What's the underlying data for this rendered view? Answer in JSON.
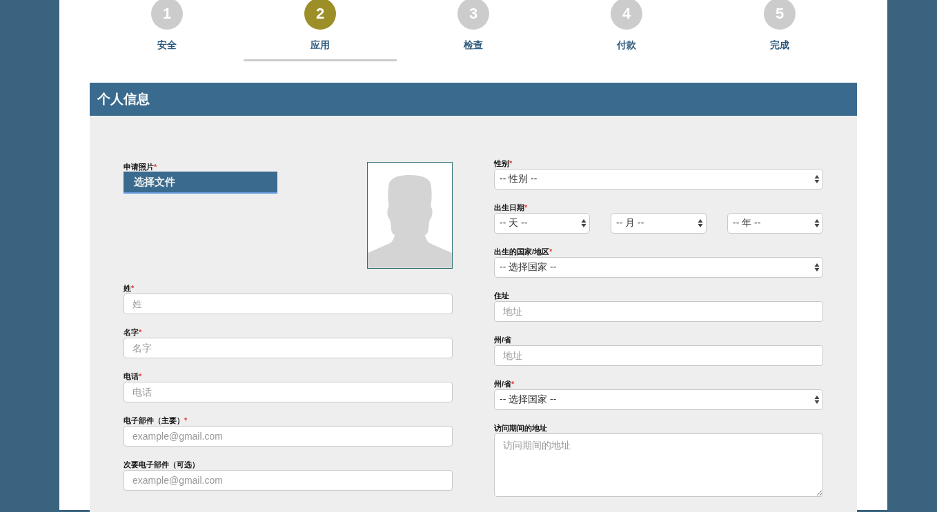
{
  "steps": [
    {
      "number": "1",
      "label": "安全",
      "selected": false
    },
    {
      "number": "2",
      "label": "应用",
      "selected": true
    },
    {
      "number": "3",
      "label": "检查",
      "selected": false
    },
    {
      "number": "4",
      "label": "付款",
      "selected": false
    },
    {
      "number": "5",
      "label": "完成",
      "selected": false
    }
  ],
  "section": {
    "title": "个人信息",
    "left_fields": [
      {
        "kind": "photo",
        "label": "申请照片",
        "required_mark": "*",
        "button": "选择文件"
      },
      {
        "kind": "text",
        "label": "姓",
        "required_mark": "*",
        "placeholder": "姓"
      },
      {
        "kind": "text",
        "label": "名字",
        "required_mark": "*",
        "placeholder": "名字"
      },
      {
        "kind": "text",
        "label": "电话",
        "required_mark": "*",
        "placeholder": "电话"
      },
      {
        "kind": "text",
        "label": "电子部件（主要）",
        "required_mark": "*",
        "placeholder": "example@gmail.com"
      },
      {
        "kind": "text",
        "label": "次要电子部件（可选）",
        "placeholder": "example@gmail.com"
      }
    ],
    "right_fields": [
      {
        "kind": "select",
        "label": "性别",
        "required_mark": "*",
        "value": "-- 性别 --"
      },
      {
        "kind": "date",
        "label": "出生日期",
        "required_mark": "*",
        "selects": [
          "-- 天 --",
          "-- 月 --",
          "-- 年 --"
        ]
      },
      {
        "kind": "select",
        "label": "出生的国家/地区",
        "required_mark": "*",
        "value": "-- 选择国家 --"
      },
      {
        "kind": "text",
        "label": "住址",
        "placeholder": "地址"
      },
      {
        "kind": "text",
        "label": "州/省",
        "placeholder": "地址"
      },
      {
        "kind": "select",
        "label": "州/省",
        "required_mark": "*",
        "value": "-- 选择国家 --"
      },
      {
        "kind": "textarea",
        "label": "访问期间的地址",
        "placeholder": "访问期间的地址"
      }
    ]
  }
}
